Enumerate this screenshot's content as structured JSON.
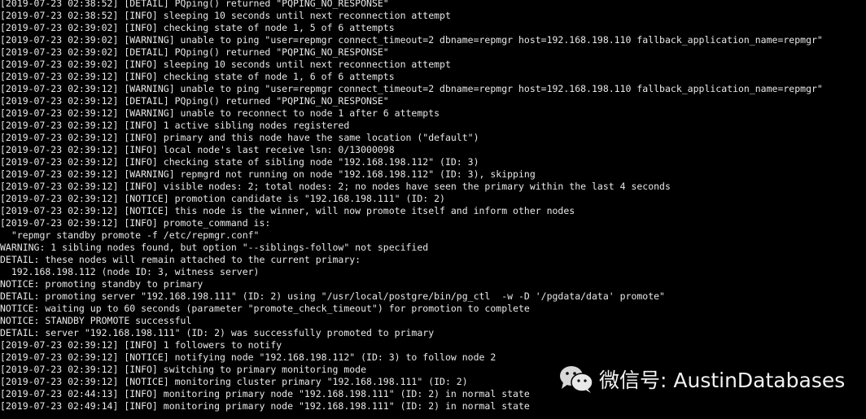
{
  "terminal": {
    "lines": [
      "[2019-07-23 02:38:52] [DETAIL] PQping() returned \"PQPING_NO_RESPONSE\"",
      "[2019-07-23 02:38:52] [INFO] sleeping 10 seconds until next reconnection attempt",
      "[2019-07-23 02:39:02] [INFO] checking state of node 1, 5 of 6 attempts",
      "[2019-07-23 02:39:02] [WARNING] unable to ping \"user=repmgr connect_timeout=2 dbname=repmgr host=192.168.198.110 fallback_application_name=repmgr\"",
      "[2019-07-23 02:39:02] [DETAIL] PQping() returned \"PQPING_NO_RESPONSE\"",
      "[2019-07-23 02:39:02] [INFO] sleeping 10 seconds until next reconnection attempt",
      "[2019-07-23 02:39:12] [INFO] checking state of node 1, 6 of 6 attempts",
      "[2019-07-23 02:39:12] [WARNING] unable to ping \"user=repmgr connect_timeout=2 dbname=repmgr host=192.168.198.110 fallback_application_name=repmgr\"",
      "[2019-07-23 02:39:12] [DETAIL] PQping() returned \"PQPING_NO_RESPONSE\"",
      "[2019-07-23 02:39:12] [WARNING] unable to reconnect to node 1 after 6 attempts",
      "[2019-07-23 02:39:12] [INFO] 1 active sibling nodes registered",
      "[2019-07-23 02:39:12] [INFO] primary and this node have the same location (\"default\")",
      "[2019-07-23 02:39:12] [INFO] local node's last receive lsn: 0/13000098",
      "[2019-07-23 02:39:12] [INFO] checking state of sibling node \"192.168.198.112\" (ID: 3)",
      "[2019-07-23 02:39:12] [WARNING] repmgrd not running on node \"192.168.198.112\" (ID: 3), skipping",
      "[2019-07-23 02:39:12] [INFO] visible nodes: 2; total nodes: 2; no nodes have seen the primary within the last 4 seconds",
      "[2019-07-23 02:39:12] [NOTICE] promotion candidate is \"192.168.198.111\" (ID: 2)",
      "[2019-07-23 02:39:12] [NOTICE] this node is the winner, will now promote itself and inform other nodes",
      "[2019-07-23 02:39:12] [INFO] promote_command is:",
      "  \"repmgr standby promote -f /etc/repmgr.conf\"",
      "WARNING: 1 sibling nodes found, but option \"--siblings-follow\" not specified",
      "DETAIL: these nodes will remain attached to the current primary:",
      "  192.168.198.112 (node ID: 3, witness server)",
      "NOTICE: promoting standby to primary",
      "DETAIL: promoting server \"192.168.198.111\" (ID: 2) using \"/usr/local/postgre/bin/pg_ctl  -w -D '/pgdata/data' promote\"",
      "NOTICE: waiting up to 60 seconds (parameter \"promote_check_timeout\") for promotion to complete",
      "NOTICE: STANDBY PROMOTE successful",
      "DETAIL: server \"192.168.198.111\" (ID: 2) was successfully promoted to primary",
      "[2019-07-23 02:39:12] [INFO] 1 followers to notify",
      "[2019-07-23 02:39:12] [NOTICE] notifying node \"192.168.198.112\" (ID: 3) to follow node 2",
      "[2019-07-23 02:39:12] [INFO] switching to primary monitoring mode",
      "[2019-07-23 02:39:12] [NOTICE] monitoring cluster primary \"192.168.198.111\" (ID: 2)",
      "[2019-07-23 02:44:13] [INFO] monitoring primary node \"192.168.198.111\" (ID: 2) in normal state",
      "[2019-07-23 02:49:14] [INFO] monitoring primary node \"192.168.198.111\" (ID: 2) in normal state"
    ]
  },
  "watermark": {
    "icon": "wechat-icon",
    "text": "微信号: AustinDatabases"
  },
  "colors": {
    "background": "#000000",
    "text": "#e8e8e8"
  }
}
